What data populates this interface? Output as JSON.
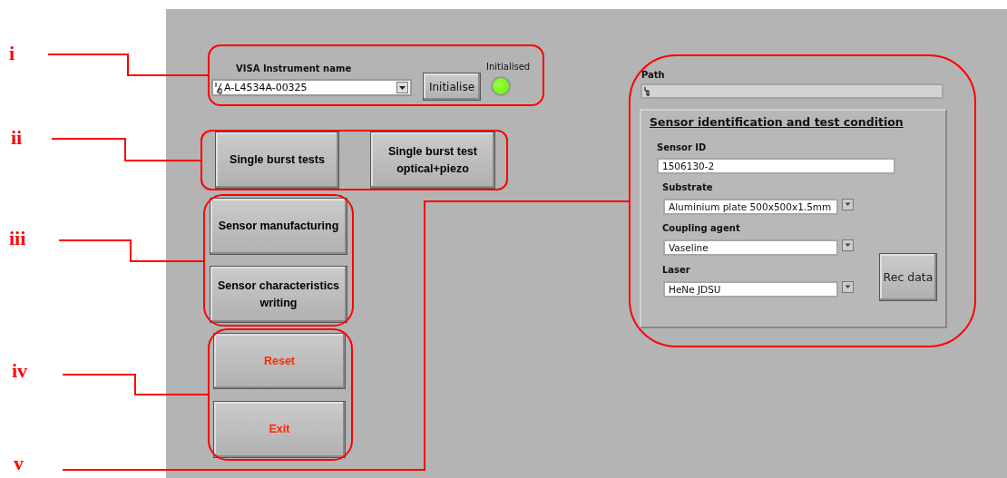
{
  "callouts": [
    {
      "label": "i"
    },
    {
      "label": "ii"
    },
    {
      "label": "iii"
    },
    {
      "label": "iv"
    },
    {
      "label": "v"
    }
  ],
  "instrument": {
    "label": "VISA Instrument name",
    "value": "A-L4534A-00325",
    "button": "Initialise"
  },
  "indicator": {
    "label": "Initialised",
    "on": true
  },
  "buttons": [
    {
      "label": "Single burst tests",
      "color": "#000000"
    },
    {
      "label": "Single burst test optical+piezo",
      "color": "#000000"
    },
    {
      "label": "Sensor manufacturing",
      "color": "#000000"
    },
    {
      "label": "Sensor characteristics writing",
      "color": "#000000"
    },
    {
      "label": "Reset",
      "color": "#ff2a00"
    },
    {
      "label": "Exit",
      "color": "#ff2a00"
    }
  ],
  "path": {
    "label": "Path"
  },
  "sensor_panel": {
    "title": "Sensor identification and test condition",
    "sensor_id": {
      "label": "Sensor ID",
      "value": "1506130-2"
    },
    "rings": [
      {
        "label": "Substrate",
        "value": "Aluminium plate 500x500x1.5mm"
      },
      {
        "label": "Coupling agent",
        "value": "Vaseline"
      },
      {
        "label": "Laser",
        "value": "HeNe JDSU"
      }
    ],
    "button": "Rec data"
  }
}
